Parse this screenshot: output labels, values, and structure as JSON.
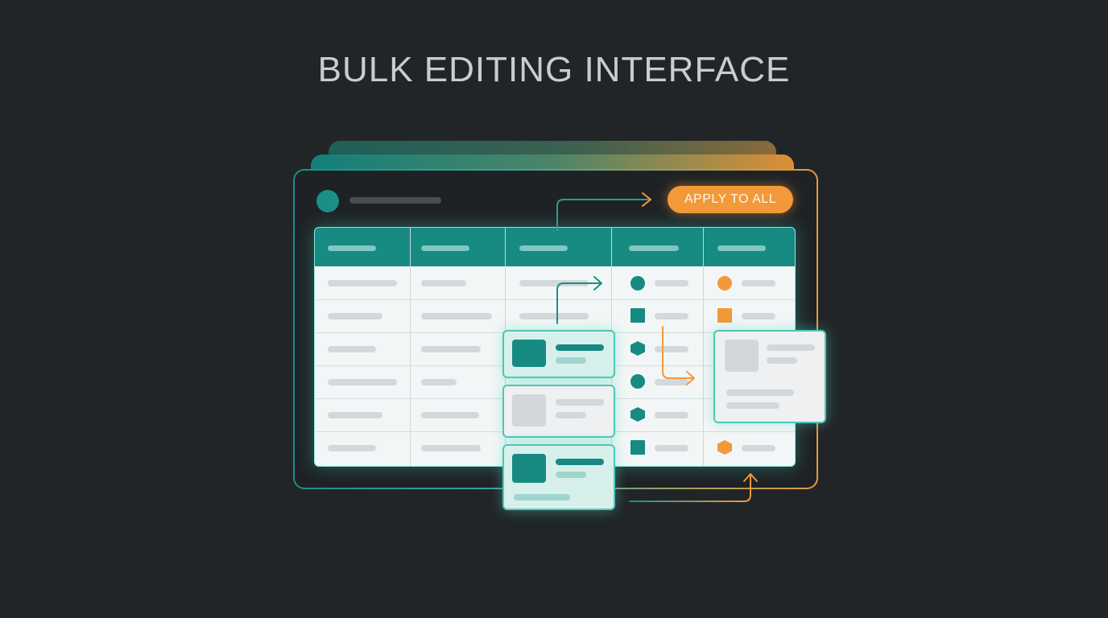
{
  "title": "BULK EDITING INTERFACE",
  "apply_button": {
    "label": "APPLY TO ALL"
  },
  "colors": {
    "background": "#222528",
    "teal": "#178a82",
    "orange": "#f2993a",
    "table_bg": "#f3f6f6"
  },
  "table": {
    "columns": 5,
    "rows": 6,
    "status_icons": {
      "column_4": [
        "circle-icon",
        "square-icon",
        "hexagon-icon",
        "circle-icon",
        "hexagon-icon",
        "square-icon"
      ],
      "column_5": [
        "circle-icon",
        "square-icon",
        "",
        "",
        "",
        "hexagon-icon"
      ]
    }
  },
  "cards": [
    "selected-card",
    "unselected-card",
    "selected-card",
    "detail-panel"
  ],
  "icons": [
    "window-dot-icon",
    "arrow-icon"
  ]
}
